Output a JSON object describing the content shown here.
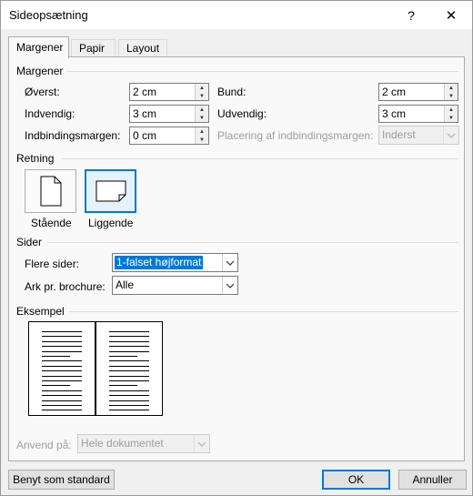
{
  "window": {
    "title": "Sideopsætning",
    "help_glyph": "?",
    "close_glyph": "✕"
  },
  "tabs": [
    {
      "label": "Margener",
      "active": true
    },
    {
      "label": "Papir",
      "active": false
    },
    {
      "label": "Layout",
      "active": false
    }
  ],
  "margins": {
    "section_label": "Margener",
    "top": {
      "label": "Øverst:",
      "value": "2 cm"
    },
    "bottom": {
      "label": "Bund:",
      "value": "2 cm"
    },
    "inside": {
      "label": "Indvendig:",
      "value": "3 cm"
    },
    "outside": {
      "label": "Udvendig:",
      "value": "3 cm"
    },
    "gutter": {
      "label": "Indbindingsmargen:",
      "value": "0 cm"
    },
    "gutter_position": {
      "label": "Placering af indbindingsmargen:",
      "value": "Inderst"
    }
  },
  "orientation": {
    "section_label": "Retning",
    "portrait_label": "Stående",
    "landscape_label": "Liggende",
    "selected": "landscape"
  },
  "pages": {
    "section_label": "Sider",
    "multiple_pages": {
      "label": "Flere sider:",
      "value": "1-falset højformat"
    },
    "sheets_per_booklet": {
      "label": "Ark pr. brochure:",
      "value": "Alle"
    }
  },
  "preview": {
    "section_label": "Eksempel"
  },
  "apply_to": {
    "label": "Anvend på:",
    "value": "Hele dokumentet"
  },
  "buttons": {
    "set_default": "Benyt som standard",
    "ok": "OK",
    "cancel": "Annuller"
  },
  "colors": {
    "accent": "#0078d7",
    "dialog_bg": "#f0f0f0",
    "panel_bg": "#f9f9f9",
    "disabled_text": "#9d9d9d"
  },
  "icons": {
    "spin_up": "up-arrow-icon",
    "spin_down": "down-arrow-icon",
    "dropdown": "chevron-down-icon"
  }
}
